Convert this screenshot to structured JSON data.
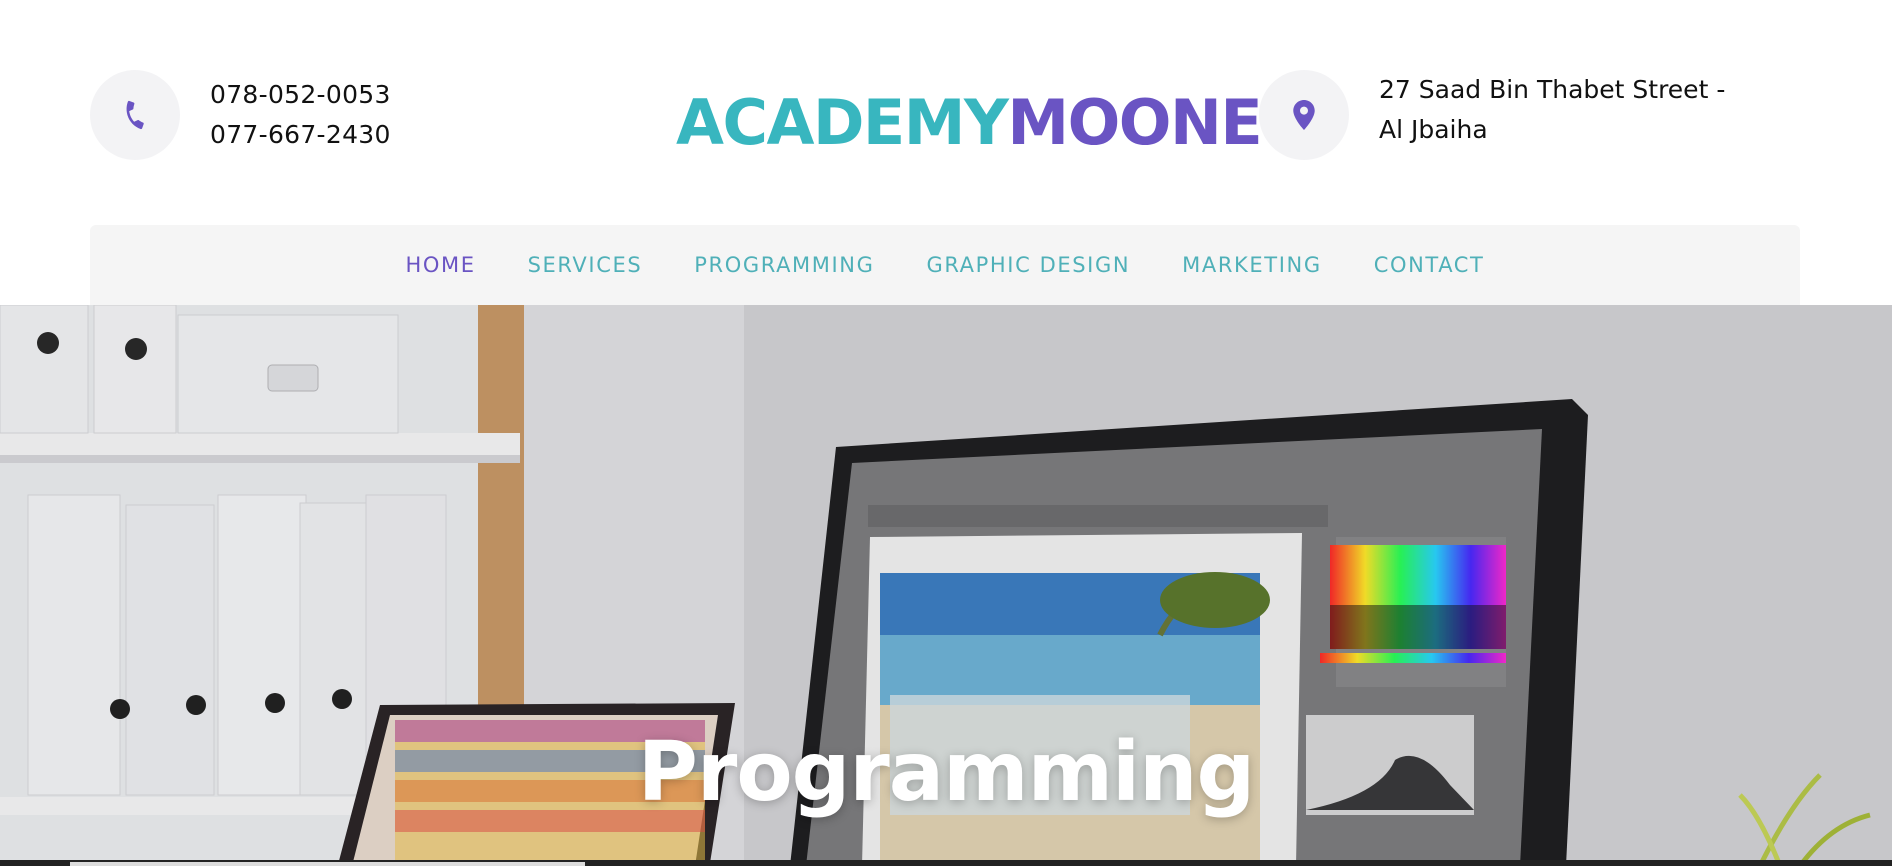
{
  "header": {
    "phones": [
      "078-052-0053",
      "077-667-2430"
    ],
    "logo": {
      "part1": "ACADEMY",
      "part2": "MOONE"
    },
    "address": "27 Saad Bin Thabet Street - Al Jbaiha",
    "icons": {
      "phone": "phone-icon",
      "location": "map-pin-icon"
    }
  },
  "nav": {
    "items": [
      {
        "label": "HOME",
        "active": true
      },
      {
        "label": "SERVICES",
        "active": false
      },
      {
        "label": "PROGRAMMING",
        "active": false
      },
      {
        "label": "GRAPHIC DESIGN",
        "active": false
      },
      {
        "label": "MARKETING",
        "active": false
      },
      {
        "label": "CONTACT",
        "active": false
      }
    ]
  },
  "hero": {
    "title": "Programming"
  },
  "colors": {
    "teal": "#38b6bf",
    "purple": "#6a54c3",
    "nav_bg": "#f5f5f5"
  }
}
